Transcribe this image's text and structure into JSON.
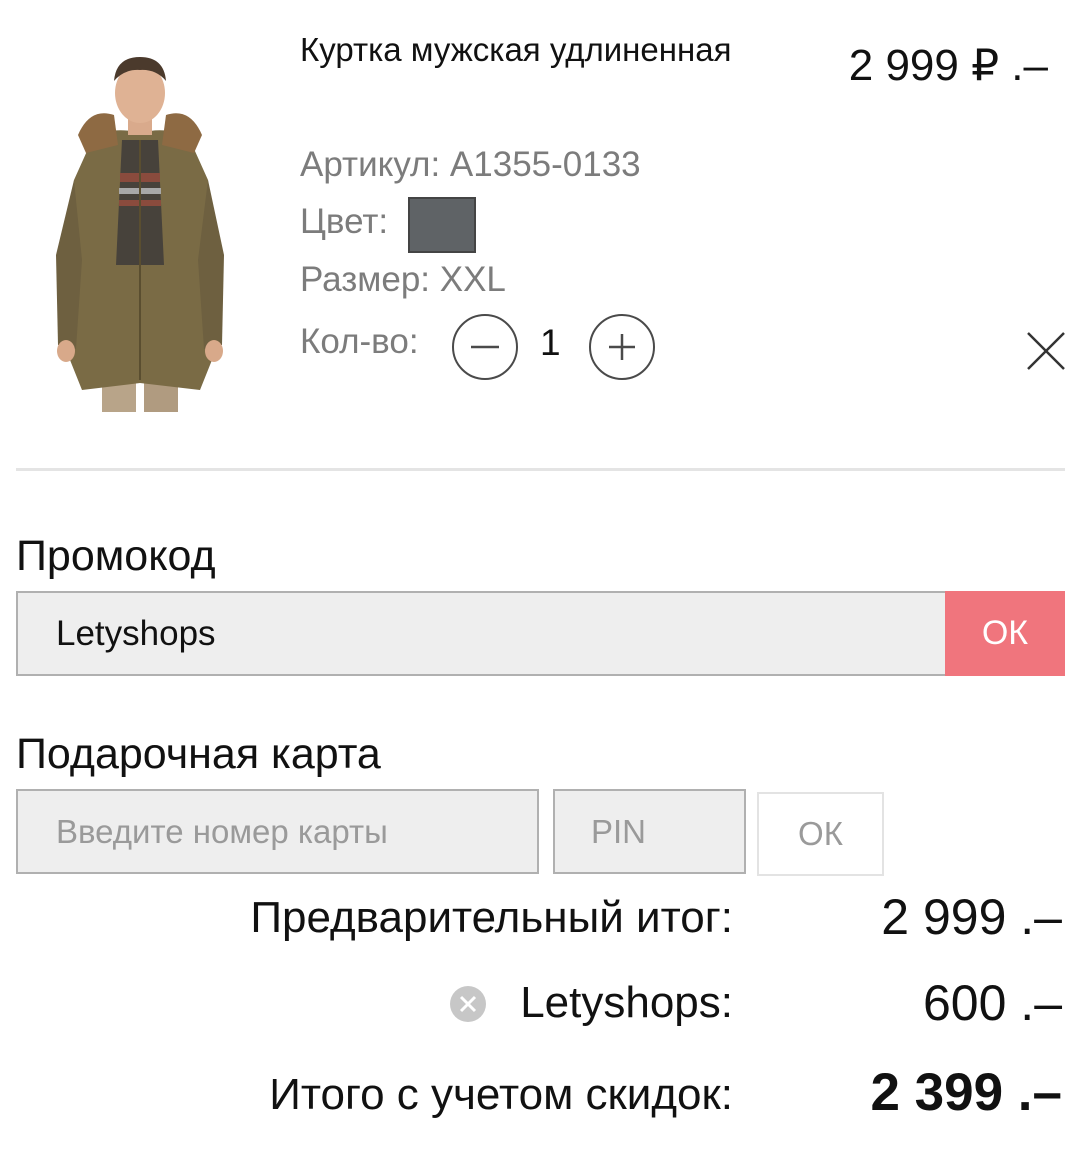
{
  "cart_item": {
    "image_alt": "Куртка мужская удлиненная",
    "title": "Куртка мужская удлиненная",
    "price": "2 999 ₽ .–",
    "sku": "Артикул: A1355-0133",
    "color_label": "Цвет:",
    "color_swatch_hex": "#5f6366",
    "size": "Размер: XXL",
    "quantity_label": "Кол-во:",
    "quantity": "1",
    "icons": {
      "decrease": "minus-icon",
      "increase": "plus-icon",
      "remove": "close-icon"
    }
  },
  "promo": {
    "label": "Промокод",
    "value": "Letyshops",
    "button_label": "ОК",
    "accent_color": "#f0757d"
  },
  "gift_card": {
    "label": "Подарочная карта",
    "number_placeholder": "Введите номер карты",
    "pin_placeholder": "PIN",
    "button_label": "ОК"
  },
  "summary": {
    "subtotal_label": "Предварительный итог:",
    "subtotal_value": "2 999 .–",
    "discount_label": "Letyshops:",
    "discount_value": "600 .–",
    "discount_icon": "clear-circle-icon",
    "total_label": "Итого с учетом скидок:",
    "total_value": "2 399 .–"
  }
}
